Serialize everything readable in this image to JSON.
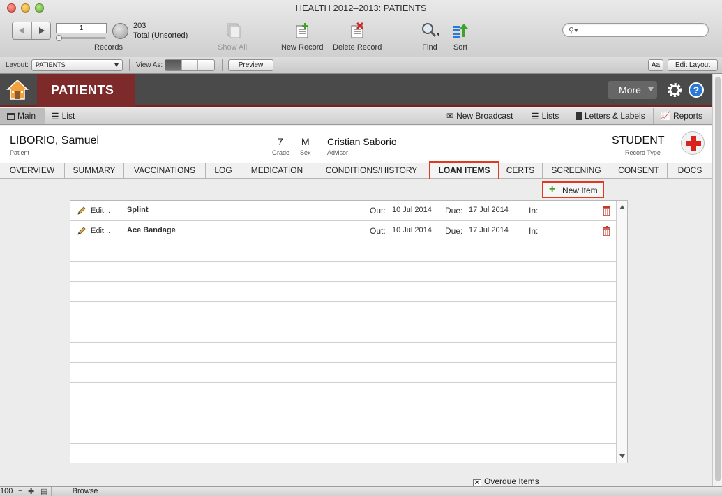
{
  "window": {
    "title": "HEALTH  2012–2013: PATIENTS"
  },
  "toolbar": {
    "record_number": "1",
    "records_label": "Records",
    "record_count": "203",
    "record_total": "Total (Unsorted)",
    "show_all": "Show All",
    "new_record": "New Record",
    "delete_record": "Delete Record",
    "find": "Find",
    "sort": "Sort",
    "search_placeholder": ""
  },
  "layout_bar": {
    "layout_label": "Layout:",
    "layout_value": "PATIENTS",
    "view_as_label": "View As:",
    "preview": "Preview",
    "font_toggle": "Aa",
    "edit_layout": "Edit Layout"
  },
  "header": {
    "title": "PATIENTS",
    "more": "More",
    "help": "?"
  },
  "subnav": {
    "main": "Main",
    "list": "List",
    "new_broadcast": "New Broadcast",
    "lists": "Lists",
    "letters_labels": "Letters & Labels",
    "reports": "Reports"
  },
  "record": {
    "name": "LIBORIO, Samuel",
    "name_label": "Patient",
    "grade": "7",
    "grade_label": "Grade",
    "sex": "M",
    "sex_label": "Sex",
    "advisor": "Cristian Saborio",
    "advisor_label": "Advisor",
    "record_type": "STUDENT",
    "record_type_label": "Record Type"
  },
  "tabs": [
    "OVERVIEW",
    "SUMMARY",
    "VACCINATIONS",
    "LOG",
    "MEDICATION",
    "CONDITIONS/HISTORY",
    "LOAN ITEMS",
    "CERTS",
    "SCREENING",
    "CONSENT",
    "DOCS"
  ],
  "active_tab": "LOAN ITEMS",
  "loan_items": {
    "new_item": "New Item",
    "edit_label": "Edit...",
    "out_label": "Out:",
    "due_label": "Due:",
    "in_label": "In:",
    "rows": [
      {
        "item": "Splint",
        "out": "10 Jul 2014",
        "due": "17 Jul 2014",
        "in": ""
      },
      {
        "item": "Ace Bandage",
        "out": "10 Jul 2014",
        "due": "17 Jul 2014",
        "in": ""
      }
    ],
    "overdue_label": "Overdue Items",
    "overdue_checked": "✕"
  },
  "status_bar": {
    "zoom": "100",
    "mode": "Browse"
  },
  "colors": {
    "accent_red": "#7c2a2a",
    "highlight": "#e23a1f",
    "header_dark": "#4a4a4a",
    "help_blue": "#2b78d6"
  }
}
